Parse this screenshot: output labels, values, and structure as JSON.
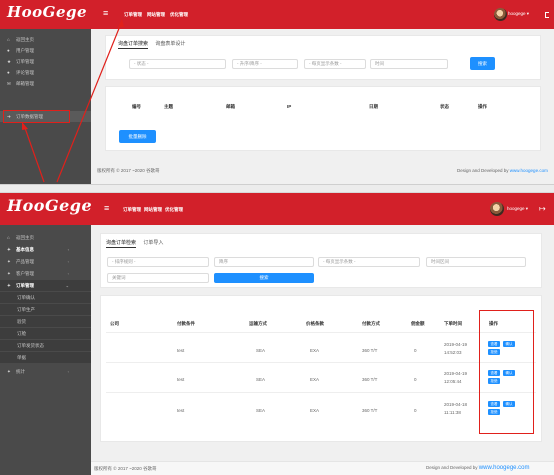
{
  "brand": {
    "logo": "HooGege",
    "accent": "#d2202a",
    "highlight": "#e0201b"
  },
  "shot1": {
    "topnav": [
      "订单管理",
      "网站管理",
      "优化管理"
    ],
    "user": "hoogege",
    "user_caret": "▾",
    "sidebar": [
      {
        "icon": "home-icon",
        "glyph": "⌂",
        "label": "返回主页"
      },
      {
        "icon": "user-icon",
        "glyph": "●",
        "label": "用户管理"
      },
      {
        "icon": "star-icon",
        "glyph": "★",
        "label": "订单管理"
      },
      {
        "icon": "comment-icon",
        "glyph": "●",
        "label": "评论管理"
      },
      {
        "icon": "mail-icon",
        "glyph": "✉",
        "label": "邮箱管理"
      },
      {
        "icon": "arrow-icon",
        "glyph": "➔",
        "label": "订单数据管理"
      }
    ],
    "tabs": {
      "active": "询盘订单搜索",
      "other": "询盘表单设计"
    },
    "filters": [
      {
        "value": "- 状态 -"
      },
      {
        "value": "- 升序/降序 -"
      },
      {
        "value": "- 每页显示条数 -"
      },
      {
        "placeholder": "时间"
      }
    ],
    "search_label": "搜索",
    "table_headers": [
      "编号",
      "主题",
      "邮箱",
      "IP",
      "日期",
      "状态",
      "操作"
    ],
    "batch_delete_label": "批量删除",
    "footer_left": "版权所有 © 2017 ~2020 谷歌哥",
    "footer_right": "Design and Developed by ",
    "footer_link": "www.hoogege.com"
  },
  "shot2": {
    "topnav": [
      "订单管理",
      "网站管理",
      "优化管理"
    ],
    "user": "hoogege",
    "user_caret": "▾",
    "logout_glyph": "↦",
    "sidebar": [
      {
        "icon": "home-icon",
        "glyph": "⌂",
        "label": "返回主页",
        "chevron": ""
      },
      {
        "icon": "pin-icon",
        "glyph": "✦",
        "label": "基本信息",
        "chevron": "‹",
        "bold": true
      },
      {
        "icon": "gear-icon",
        "glyph": "✦",
        "label": "产品管理",
        "chevron": "‹"
      },
      {
        "icon": "user-icon",
        "glyph": "✦",
        "label": "客户管理",
        "chevron": "‹"
      },
      {
        "icon": "pin-icon",
        "glyph": "✦",
        "label": "订单管理",
        "chevron": "⌄",
        "bold": true
      },
      {
        "icon": "",
        "glyph": "",
        "label": "订单确认",
        "chevron": ""
      },
      {
        "icon": "",
        "glyph": "",
        "label": "订单生产",
        "chevron": ""
      },
      {
        "icon": "",
        "glyph": "",
        "label": "验货",
        "chevron": ""
      },
      {
        "icon": "",
        "glyph": "",
        "label": "订舱",
        "chevron": ""
      },
      {
        "icon": "",
        "glyph": "",
        "label": "订单发货状态",
        "chevron": ""
      },
      {
        "icon": "",
        "glyph": "",
        "label": "单据",
        "chevron": ""
      },
      {
        "icon": "pin-icon",
        "glyph": "✦",
        "label": "统计",
        "chevron": "‹"
      }
    ],
    "tabs": {
      "active": "询盘订单检索",
      "other": "订单导入"
    },
    "filters_row1": [
      {
        "value": "- 排序规则 -"
      },
      {
        "value": "降序"
      },
      {
        "value": "- 每页显示条数 -"
      },
      {
        "placeholder": "时间区间"
      }
    ],
    "filters_row2": [
      {
        "placeholder": "关键词"
      }
    ],
    "search_label": "搜索",
    "table_headers": [
      "公司",
      "付款条件",
      "运输方式",
      "价格条款",
      "付款方式",
      "佣金额",
      "下单时间",
      "操作"
    ],
    "rows": [
      {
        "company": "",
        "terms": "test",
        "shipping": "SEA",
        "price_terms": "EXA",
        "payment": "360 T/T",
        "commission": "0",
        "date": "2019-04-19",
        "time": "14:52:03"
      },
      {
        "company": "",
        "terms": "test",
        "shipping": "SEA",
        "price_terms": "EXA",
        "payment": "360 T/T",
        "commission": "0",
        "date": "2019-04-19",
        "time": "12:05:44"
      },
      {
        "company": "",
        "terms": "test",
        "shipping": "SEA",
        "price_terms": "EXA",
        "payment": "360 T/T",
        "commission": "0",
        "date": "2019-04-18",
        "time": "11:11:38"
      }
    ],
    "actions": {
      "view": "查看",
      "confirm": "确认",
      "reject": "拒绝"
    },
    "footer_left": "版权所有 © 2017 ~2020 谷歌哥",
    "footer_right": "Design and Developed by ",
    "footer_link": "www.hoogege.com"
  }
}
